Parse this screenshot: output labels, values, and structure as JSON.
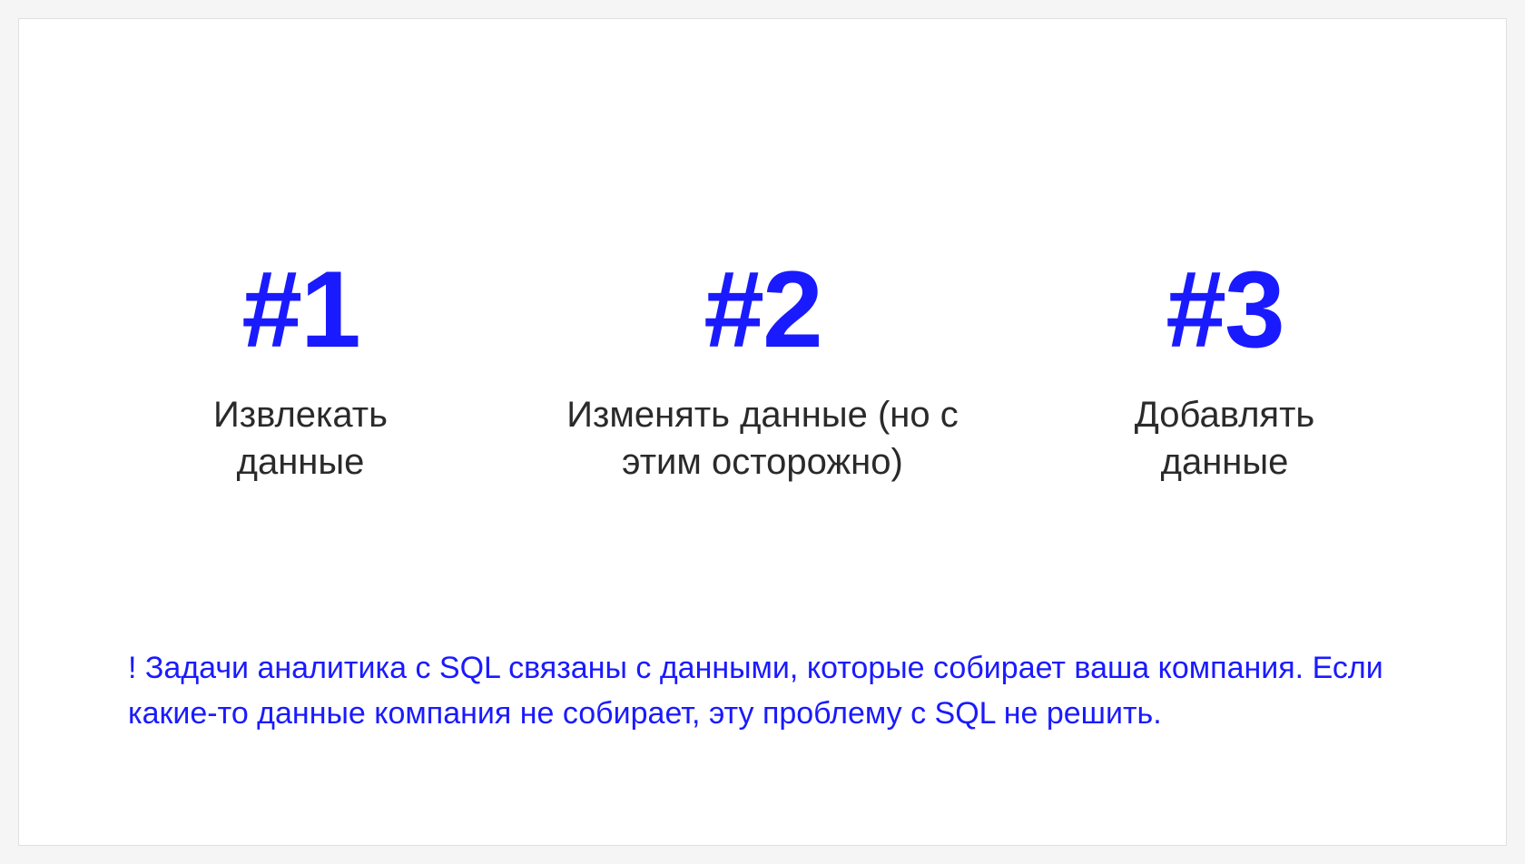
{
  "columns": [
    {
      "number": "#1",
      "description": "Извлекать данные"
    },
    {
      "number": "#2",
      "description": "Изменять данные (но с этим осторожно)"
    },
    {
      "number": "#3",
      "description": "Добавлять данные"
    }
  ],
  "note": "! Задачи аналитика с SQL связаны с данными, которые собирает ваша компания. Если какие-то данные компания не собирает, эту проблему с SQL не решить."
}
